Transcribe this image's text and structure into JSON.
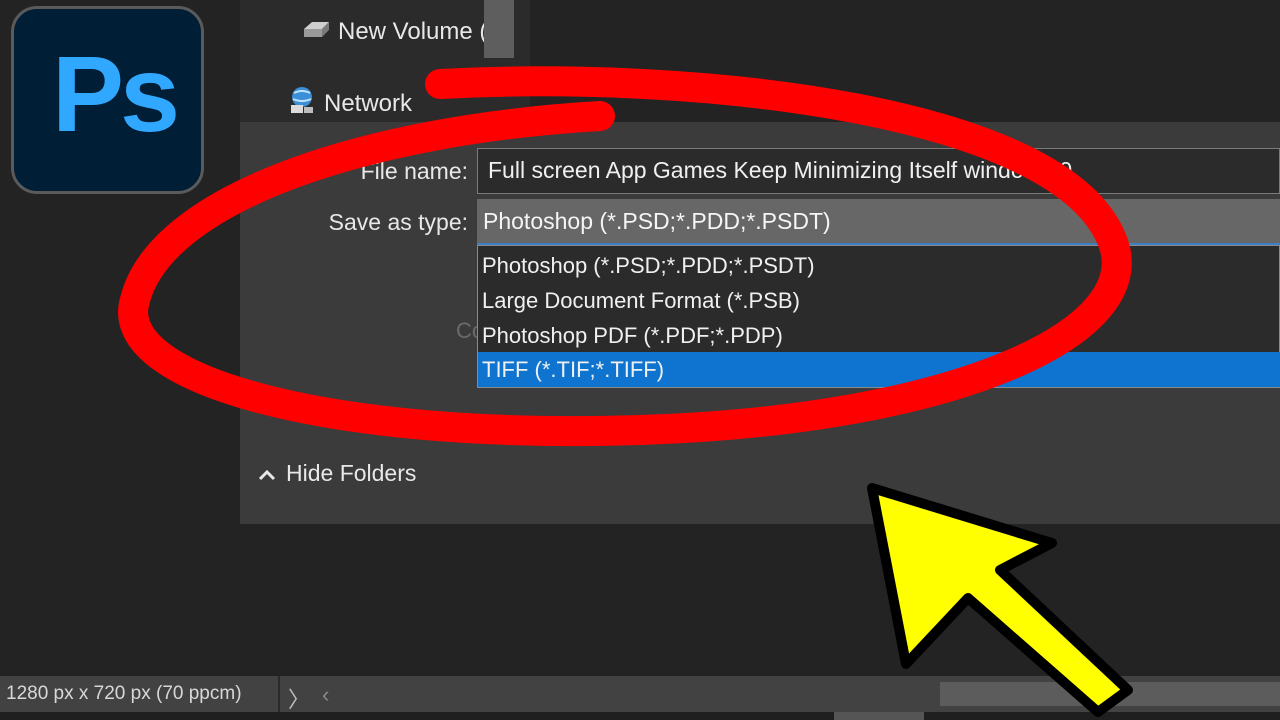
{
  "navigation": {
    "drive_label": "New Volume (E",
    "network_label": "Network"
  },
  "dialog": {
    "file_name_label": "File name:",
    "file_name_value": "Full screen App Games Keep Minimizing Itself window  10",
    "save_as_type_label": "Save as type:",
    "save_as_type_value": "Photoshop (*.PSD;*.PDD;*.PSDT)",
    "type_options": [
      {
        "label": "Photoshop (*.PSD;*.PDD;*.PSDT)",
        "selected": false
      },
      {
        "label": "Large Document Format (*.PSB)",
        "selected": false
      },
      {
        "label": "Photoshop PDF (*.PDF;*.PDP)",
        "selected": false
      },
      {
        "label": "TIFF (*.TIF;*.TIFF)",
        "selected": true
      }
    ],
    "obscured_text": "Co",
    "hide_folders_label": "Hide Folders"
  },
  "status_bar": {
    "document_info": "1280 px x 720 px (70 ppcm)",
    "next_arrow": "〉",
    "prev_arrow": "‹"
  },
  "logo": {
    "text": "Ps",
    "accent": "#31a8ff",
    "background": "#001e36"
  },
  "icons": {
    "drive": "hard-drive-icon",
    "network": "network-icon",
    "hide_folders": "chevron-up-icon"
  },
  "colors": {
    "annotation_circle": "#ff0000",
    "pointer_arrow": "#ffff00",
    "selection": "#0e74d0"
  }
}
